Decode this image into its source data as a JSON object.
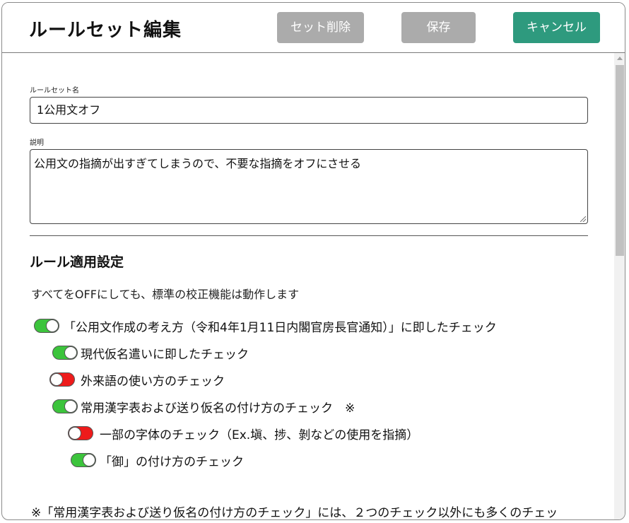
{
  "header": {
    "title": "ルールセット編集",
    "delete_label": "セット削除",
    "save_label": "保存",
    "cancel_label": "キャンセル"
  },
  "form": {
    "name_label": "ルールセット名",
    "name_value": "1公用文オフ",
    "desc_label": "説明",
    "desc_value": "公用文の指摘が出すぎてしまうので、不要な指摘をオフにさせる"
  },
  "rules_section": {
    "title": "ルール適用設定",
    "note": "すべてをOFFにしても、標準の校正機能は動作します",
    "rules": [
      {
        "label": "「公用文作成の考え方（令和4年1月11日内閣官房長官通知）」に即したチェック",
        "enabled": true,
        "level": 0
      },
      {
        "label": "現代仮名遣いに即したチェック",
        "enabled": true,
        "level": 1
      },
      {
        "label": "外来語の使い方のチェック",
        "enabled": false,
        "level": 1
      },
      {
        "label": "常用漢字表および送り仮名の付け方のチェック　※",
        "enabled": true,
        "level": 1
      },
      {
        "label": "一部の字体のチェック（Ex.塡、捗、剝などの使用を指摘）",
        "enabled": false,
        "level": 2
      },
      {
        "label": "「御」の付け方のチェック",
        "enabled": true,
        "level": 2
      }
    ],
    "footnote": "※「常用漢字表および送り仮名の付け方のチェック」には、２つのチェック以外にも多くのチェッ"
  },
  "colors": {
    "accent": "#2e9a7e",
    "disabled_button": "#ababab",
    "toggle_on": "#3cc43c",
    "toggle_off": "#ee1b1b"
  }
}
